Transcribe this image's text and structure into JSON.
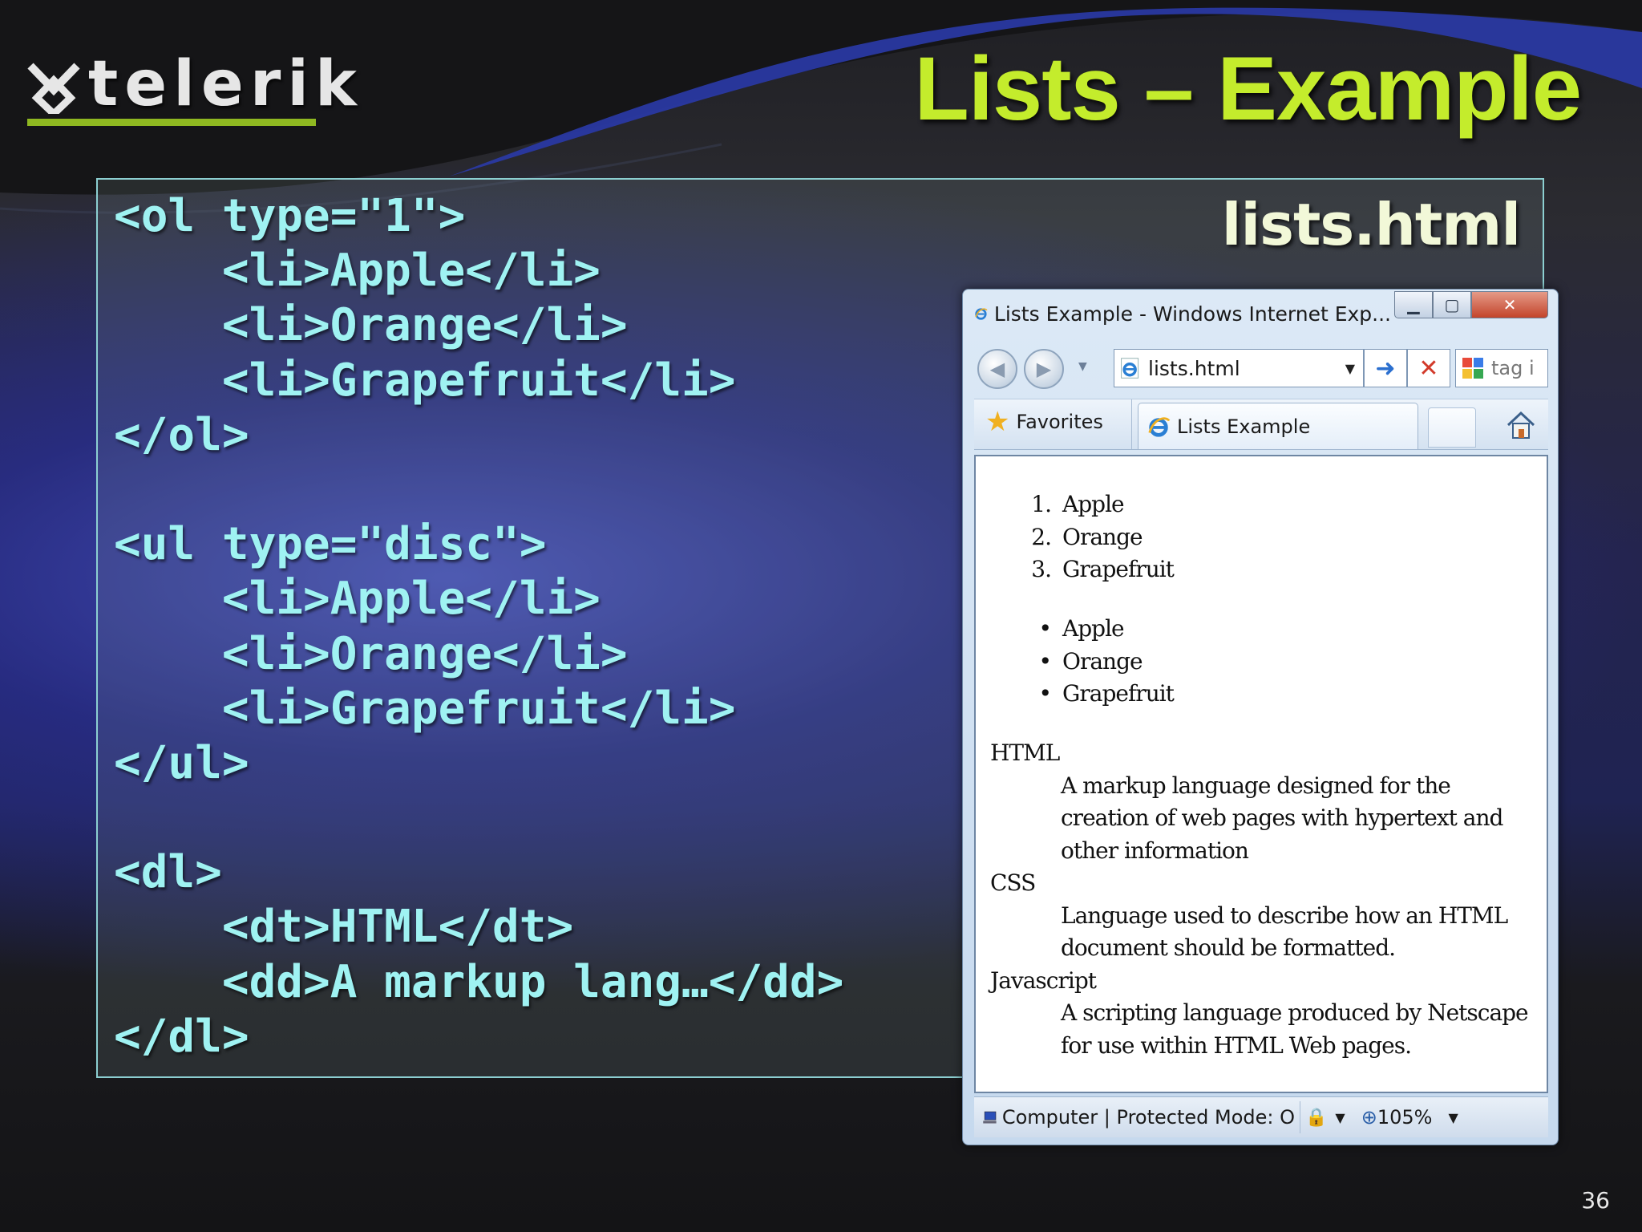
{
  "slide": {
    "title": "Lists – Example",
    "file_label": "lists.html",
    "page_number": "36",
    "logo_text": "telerik"
  },
  "code_lines": [
    "<ol type=\"1\">",
    "    <li>Apple</li>",
    "    <li>Orange</li>",
    "    <li>Grapefruit</li>",
    "</ol>",
    "",
    "<ul type=\"disc\">",
    "    <li>Apple</li>",
    "    <li>Orange</li>",
    "    <li>Grapefruit</li>",
    "</ul>",
    "",
    "<dl>",
    "    <dt>HTML</dt>",
    "    <dd>A markup lang…</dd>",
    "</dl>"
  ],
  "browser": {
    "window_title": "Lists Example - Windows Internet Exp...",
    "address": "lists.html",
    "search_text": "tag i",
    "favorites_label": "Favorites",
    "tab_label": "Lists Example",
    "status_text": "Computer | Protected Mode: O",
    "zoom": "105%",
    "ordered_list": [
      {
        "marker": "1.",
        "text": "Apple"
      },
      {
        "marker": "2.",
        "text": "Orange"
      },
      {
        "marker": "3.",
        "text": "Grapefruit"
      }
    ],
    "unordered_list": [
      {
        "marker": "•",
        "text": "Apple"
      },
      {
        "marker": "•",
        "text": "Orange"
      },
      {
        "marker": "•",
        "text": "Grapefruit"
      }
    ],
    "definitions": [
      {
        "term": "HTML",
        "definition": "A markup language designed for the creation of web pages with hypertext and other information"
      },
      {
        "term": "CSS",
        "definition": "Language used to describe how an HTML document should be formatted."
      },
      {
        "term": "Javascript",
        "definition": "A scripting language produced by Netscape for use within HTML Web pages."
      }
    ]
  },
  "colors": {
    "title_green": "#c4ec2c",
    "code_cyan": "#9ff2f2",
    "logo_underline": "#8fb821"
  }
}
